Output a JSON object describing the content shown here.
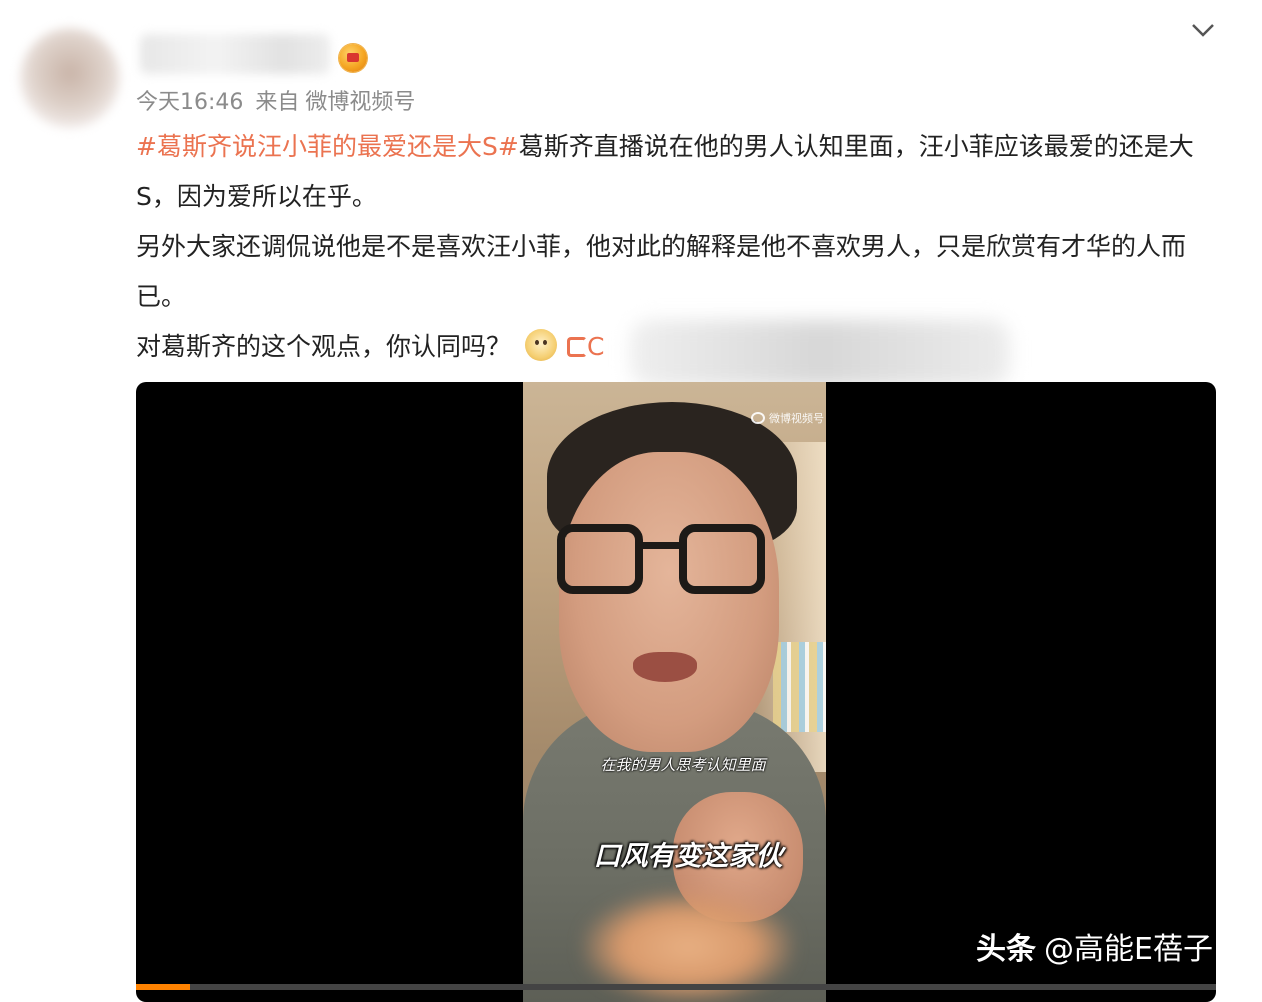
{
  "post": {
    "time": "今天16:46",
    "source_prefix": "来自",
    "source": "微博视频号",
    "hashtag": "#葛斯齐说汪小菲的最爱还是大S#",
    "para1": "葛斯齐直播说在他的男人认知里面，汪小菲应该最爱的还是大S，因为爱所以在乎。",
    "para2": "另外大家还调侃说他是不是喜欢汪小菲，他对此的解释是他不喜欢男人，只是欣赏有才华的人而已。",
    "para3": "对葛斯齐的这个观点，你认同吗？",
    "link_partial": "C"
  },
  "icons": {
    "user_badge": "vip-crown-icon",
    "menu": "chevron-down-icon",
    "emoji": "doge-emoji-icon",
    "link": "web-link-icon"
  },
  "video": {
    "subtitle_small": "在我的男人思考认知里面",
    "subtitle_big": "口风有变这家伙",
    "logo_text": "微博视频号",
    "progress": 0.05
  },
  "watermark": {
    "brand": "头条",
    "handle": "@高能E蓓子"
  },
  "colors": {
    "hashtag": "#eb7350",
    "meta": "#8b8b8b",
    "progress": "#ff8200"
  }
}
